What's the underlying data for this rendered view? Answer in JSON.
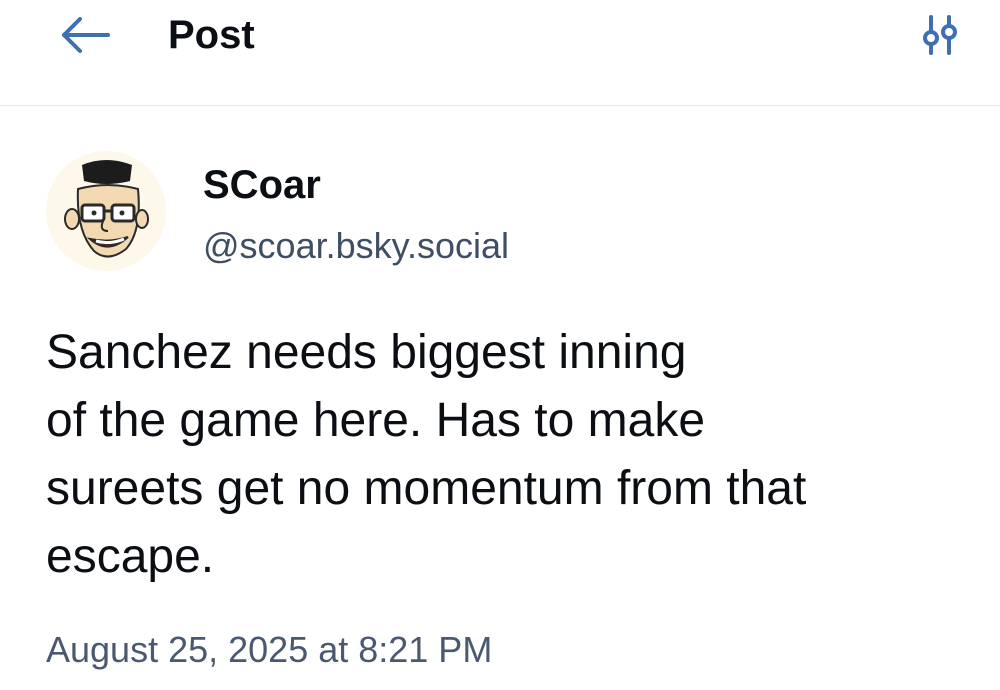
{
  "header": {
    "title": "Post",
    "back_icon": "arrow-left-icon",
    "filter_icon": "sliders-icon",
    "accent_color": "#3f6fb0"
  },
  "post": {
    "author": {
      "display_name": "SCoar",
      "handle": "@scoar.bsky.social",
      "avatar_icon": "cartoon-avatar"
    },
    "text": "Sanchez needs biggest inning\nof the game here. Has to make\nsureets get no momentum from that\nescape.",
    "timestamp": "August 25, 2025 at 8:21 PM"
  }
}
